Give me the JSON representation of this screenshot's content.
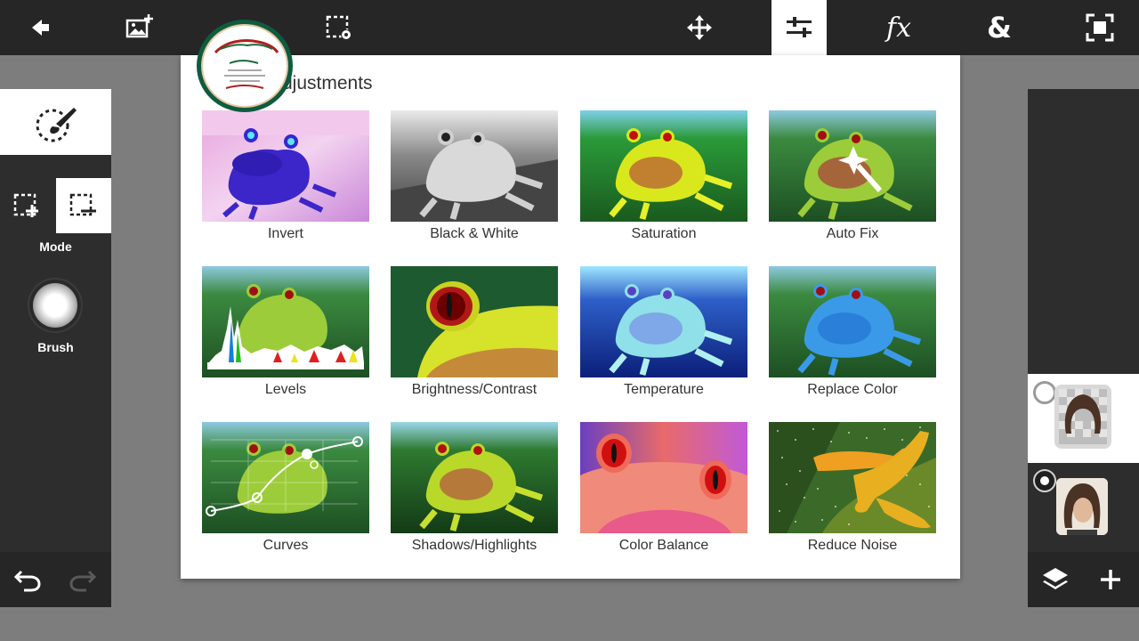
{
  "toolbar": {
    "items": [
      {
        "name": "back",
        "icon": "arrow-left-icon"
      },
      {
        "name": "add-image",
        "icon": "add-image-icon"
      },
      {
        "name": "selection-settings",
        "icon": "selection-settings-icon"
      },
      {
        "name": "move",
        "icon": "move-icon"
      },
      {
        "name": "adjustments",
        "icon": "sliders-icon",
        "active": true
      },
      {
        "name": "effects",
        "icon": "fx-icon",
        "text": "fx"
      },
      {
        "name": "blend",
        "icon": "ampersand-icon",
        "text": "&"
      },
      {
        "name": "fit-screen",
        "icon": "fit-screen-icon"
      }
    ]
  },
  "left_panel": {
    "selection_brush_icon": "selection-brush-icon",
    "mode_label": "Mode",
    "brush_label": "Brush",
    "mode_options": [
      "add-selection",
      "subtract-selection"
    ],
    "selected_mode": "subtract-selection"
  },
  "dialog": {
    "title": "Adjustments",
    "tiles": [
      {
        "label": "Invert"
      },
      {
        "label": "Black & White"
      },
      {
        "label": "Saturation"
      },
      {
        "label": "Auto Fix"
      },
      {
        "label": "Levels"
      },
      {
        "label": "Brightness/Contrast"
      },
      {
        "label": "Temperature"
      },
      {
        "label": "Replace Color"
      },
      {
        "label": "Curves"
      },
      {
        "label": "Shadows/Highlights"
      },
      {
        "label": "Color Balance"
      },
      {
        "label": "Reduce Noise"
      }
    ]
  },
  "right_panel": {
    "layers": [
      {
        "name": "layer-1",
        "selected": true
      },
      {
        "name": "layer-2",
        "selected": false
      }
    ]
  },
  "colors": {
    "toolbar_bg": "#262626",
    "panel_bg": "#2d2d2d",
    "canvas_bg": "#7d7d7d",
    "active_bg": "#ffffff"
  }
}
